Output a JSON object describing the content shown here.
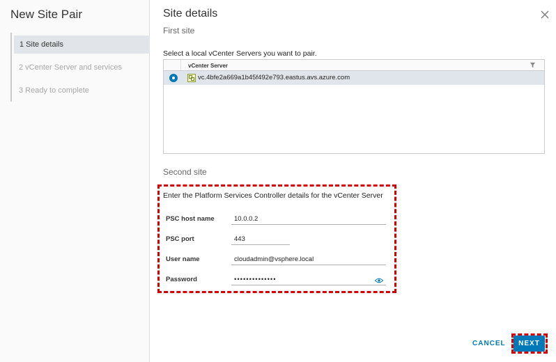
{
  "wizard": {
    "title": "New Site Pair",
    "steps": [
      {
        "label": "1 Site details",
        "active": true
      },
      {
        "label": "2 vCenter Server and services",
        "active": false
      },
      {
        "label": "3 Ready to complete",
        "active": false
      }
    ]
  },
  "page": {
    "title": "Site details",
    "first_site_title": "First site",
    "first_site_instruction": "Select a local vCenter Servers you want to pair.",
    "grid": {
      "column_header": "vCenter Server",
      "rows": [
        {
          "name": "vc.4bfe2a669a1b45f492e793.eastus.avs.azure.com",
          "selected": true
        }
      ]
    },
    "second_site_title": "Second site",
    "second_site_instruction": "Enter the Platform Services Controller details for the vCenter Server",
    "fields": {
      "psc_host_label": "PSC host name",
      "psc_host_value": "10.0.0.2",
      "psc_port_label": "PSC port",
      "psc_port_value": "443",
      "user_label": "User name",
      "user_value": "cloudadmin@vsphere.local",
      "password_label": "Password",
      "password_value": "••••••••••••••"
    }
  },
  "footer": {
    "cancel_label": "CANCEL",
    "next_label": "NEXT"
  },
  "icons": {
    "close": "close-icon",
    "filter": "filter-icon",
    "vcenter": "vcenter-icon",
    "eye": "eye-icon"
  },
  "colors": {
    "accent": "#0079b8",
    "highlight": "#d40000",
    "selected_row": "#dfe5ea"
  }
}
